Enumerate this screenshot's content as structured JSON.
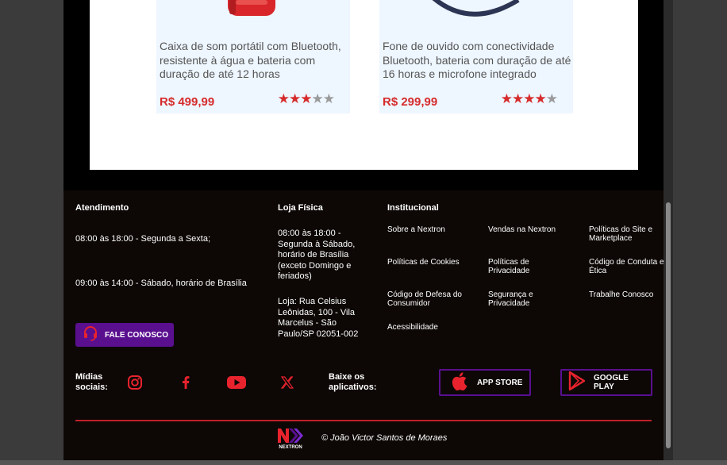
{
  "products": [
    {
      "description": "Caixa de som portátil com Bluetooth, resistente à água e bateria com duração de até 12 horas",
      "price": "R$ 499,99",
      "rating": 3,
      "rating_max": 5
    },
    {
      "description": "Fone de ouvido com conectividade Bluetooth, bateria com duração de até 16 horas e microfone integrado",
      "price": "R$ 299,99",
      "rating": 4,
      "rating_max": 5
    }
  ],
  "footer": {
    "atendimento": {
      "title": "Atendimento",
      "line1": "08:00 às 18:00 - Segunda a Sexta;",
      "line2": "09:00 às 14:00 - Sábado, horário de Brasília",
      "contact_button": "FALE CONOSCO"
    },
    "loja": {
      "title": "Loja Física",
      "hours": "08:00 às 18:00 - Segunda à Sábado, horário de Brasília (exceto Domingo e feriados)",
      "address": "Loja: Rua Celsius Leônidas, 100 - Vila Marcelus - São Paulo/SP 02051-002"
    },
    "institucional": {
      "title": "Institucional",
      "links": [
        "Sobre a Nextron",
        "Vendas na Nextron",
        "Políticas do Site e Marketplace",
        "Políticas de Cookies",
        "Políticas de Privacidade",
        "Código de Conduta e Ética",
        "Código de Defesa do Consumidor",
        "Segurança e Privacidade",
        "Trabalhe Conosco",
        "Acessibilidade"
      ]
    },
    "social": {
      "label": "Mídias sociais:",
      "icons": [
        "instagram-icon",
        "facebook-icon",
        "youtube-icon",
        "x-icon"
      ]
    },
    "apps": {
      "label": "Baixe os aplicativos:",
      "app_store": "APP STORE",
      "google_play": "GOOGLE PLAY"
    },
    "logo_text": "NEXTRON",
    "copyright": "© João Victor Santos de Moraes"
  },
  "colors": {
    "accent": "#d62b2b",
    "purple": "#5a0f8f",
    "footer_bg": "#0d0806"
  }
}
